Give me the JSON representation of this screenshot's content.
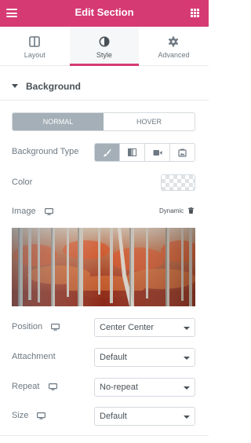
{
  "header": {
    "title": "Edit Section"
  },
  "tabs": [
    {
      "label": "Layout",
      "active": false
    },
    {
      "label": "Style",
      "active": true
    },
    {
      "label": "Advanced",
      "active": false
    }
  ],
  "section": {
    "title": "Background"
  },
  "state_switch": {
    "normal": "NORMAL",
    "hover": "HOVER",
    "active": "NORMAL"
  },
  "fields": {
    "background_type": {
      "label": "Background Type",
      "options": [
        "classic-brush-icon",
        "gradient-icon",
        "video-icon",
        "slideshow-icon"
      ],
      "selected": "classic-brush-icon"
    },
    "color": {
      "label": "Color"
    },
    "image": {
      "label": "Image",
      "dynamic": "Dynamic"
    },
    "position": {
      "label": "Position",
      "value": "Center Center"
    },
    "attachment": {
      "label": "Attachment",
      "value": "Default"
    },
    "repeat": {
      "label": "Repeat",
      "value": "No-repeat"
    },
    "size": {
      "label": "Size",
      "value": "Default"
    }
  },
  "colors": {
    "accent": "#d63a73",
    "toggle_active": "#a4afb7",
    "border": "#d5dadf",
    "text": "#6d7882"
  }
}
